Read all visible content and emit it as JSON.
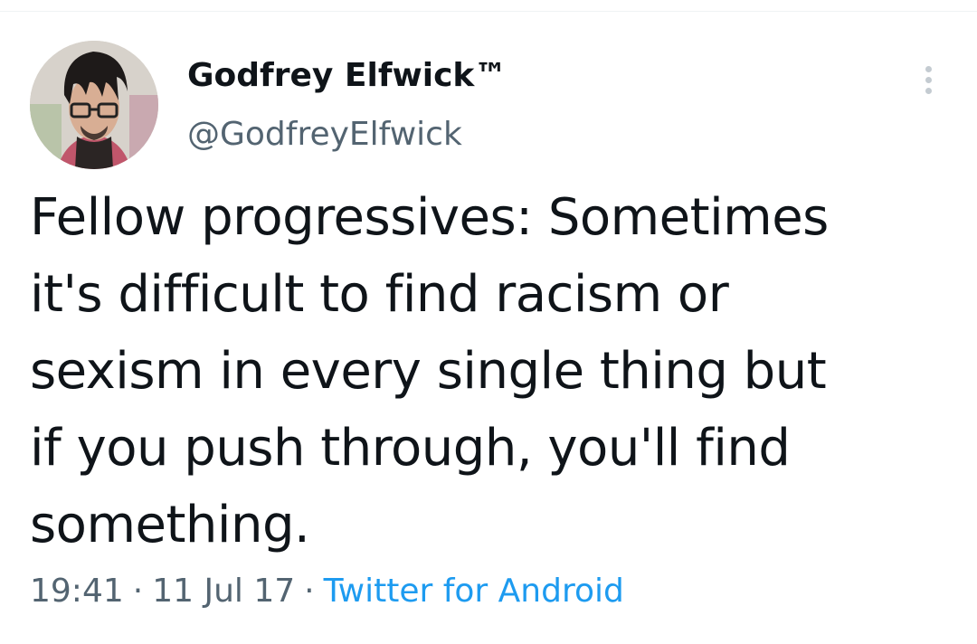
{
  "tweet": {
    "display_name": "Godfrey Elfwick™",
    "handle": "@GodfreyElfwick",
    "text": "Fellow progressives: Sometimes\nit's difficult to find racism or\nsexism in every single thing but\nif you push through, you'll find\nsomething.",
    "time": "19:41",
    "separator": "·",
    "date": "11 Jul 17",
    "source": "Twitter for Android",
    "avatar_icon": "user-avatar-photo",
    "more_icon": "more-options-icon"
  },
  "colors": {
    "text_primary": "#0f1419",
    "text_secondary": "#536471",
    "link": "#1d9bf0"
  }
}
